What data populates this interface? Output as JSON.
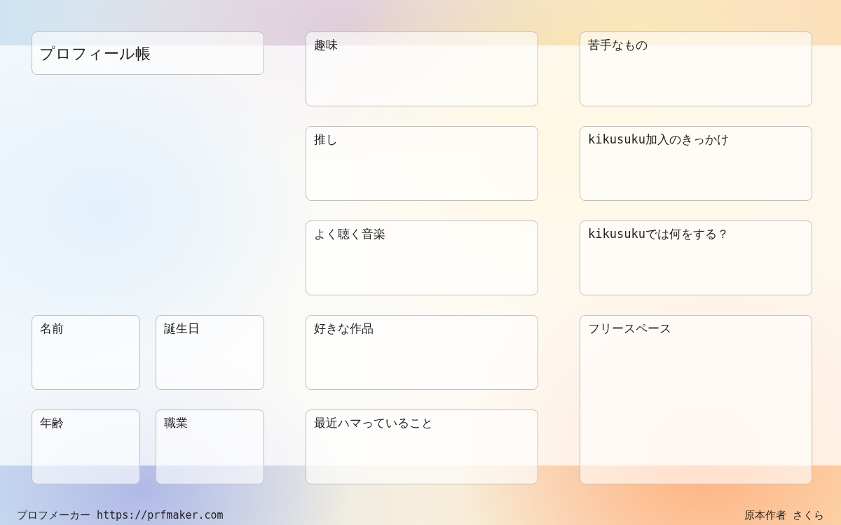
{
  "title": "プロフィール帳",
  "left_fields": [
    {
      "label": "名前"
    },
    {
      "label": "誕生日"
    },
    {
      "label": "年齢"
    },
    {
      "label": "職業"
    }
  ],
  "middle_fields": [
    {
      "label": "趣味"
    },
    {
      "label": "推し"
    },
    {
      "label": "よく聴く音楽"
    },
    {
      "label": "好きな作品"
    },
    {
      "label": "最近ハマっていること"
    }
  ],
  "right_fields": [
    {
      "label": "苦手なもの",
      "kind": "normal"
    },
    {
      "label": "kikusuku加入のきっかけ",
      "kind": "normal"
    },
    {
      "label": "kikusukuでは何をする？",
      "kind": "normal"
    },
    {
      "label": "フリースペース",
      "kind": "large"
    }
  ],
  "footer": {
    "left": "プロフメーカー https://prfmaker.com",
    "right": "原本作者 さくら"
  }
}
